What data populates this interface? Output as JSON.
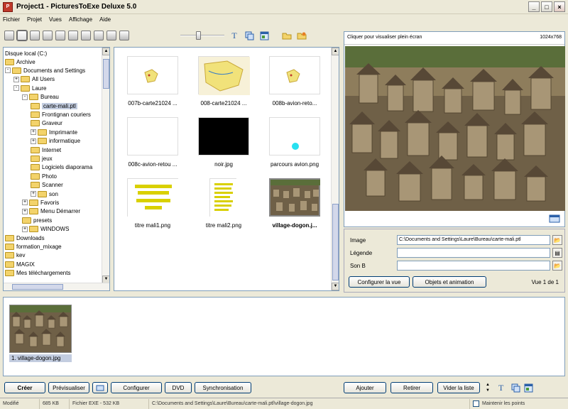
{
  "window": {
    "title": "Project1 - PicturesToExe Deluxe 5.0"
  },
  "menu": [
    "Fichier",
    "Projet",
    "Vues",
    "Affichage",
    "Aide"
  ],
  "toolbar": {
    "drives": [
      "A:",
      "C:",
      "D:",
      "E:",
      "F:",
      "G:",
      "H:",
      "I:",
      "J:",
      "K:"
    ],
    "zoom_level": 0.4
  },
  "tree": {
    "root": "Disque local (C:)",
    "items": [
      {
        "label": "Archive",
        "level": 1,
        "expander": ""
      },
      {
        "label": "Documents and Settings",
        "level": 1,
        "expander": "-"
      },
      {
        "label": "All Users",
        "level": 2,
        "expander": "+"
      },
      {
        "label": "Laure",
        "level": 2,
        "expander": "-"
      },
      {
        "label": "Bureau",
        "level": 3,
        "expander": "-"
      },
      {
        "label": "carte-mali.ptl",
        "level": 4,
        "expander": "",
        "selected": true
      },
      {
        "label": "Frontignan couriers",
        "level": 4,
        "expander": ""
      },
      {
        "label": "Graveur",
        "level": 4,
        "expander": ""
      },
      {
        "label": "Imprimante",
        "level": 4,
        "expander": "+"
      },
      {
        "label": "informatique",
        "level": 4,
        "expander": "+"
      },
      {
        "label": "Internet",
        "level": 4,
        "expander": ""
      },
      {
        "label": "jeux",
        "level": 4,
        "expander": ""
      },
      {
        "label": "Logiciels diaporama",
        "level": 4,
        "expander": ""
      },
      {
        "label": "Photo",
        "level": 4,
        "expander": ""
      },
      {
        "label": "Scanner",
        "level": 4,
        "expander": ""
      },
      {
        "label": "son",
        "level": 4,
        "expander": "+"
      },
      {
        "label": "Favoris",
        "level": 3,
        "expander": "+"
      },
      {
        "label": "Menu Démarrer",
        "level": 3,
        "expander": "+"
      },
      {
        "label": "presets",
        "level": 3,
        "expander": ""
      },
      {
        "label": "WINDOWS",
        "level": 3,
        "expander": "+"
      },
      {
        "label": "Downloads",
        "level": 1,
        "expander": ""
      },
      {
        "label": "formation_mixage",
        "level": 1,
        "expander": ""
      },
      {
        "label": "kev",
        "level": 1,
        "expander": ""
      },
      {
        "label": "MAGIX",
        "level": 1,
        "expander": ""
      },
      {
        "label": "Mes téléchargements",
        "level": 1,
        "expander": ""
      }
    ]
  },
  "files": [
    {
      "label": "007b-carte21024 ...",
      "kind": "map-small"
    },
    {
      "label": "008-carte21024 ...",
      "kind": "map"
    },
    {
      "label": "008b-avion-reto...",
      "kind": "map-small"
    },
    {
      "label": "008c-avion-retou ...",
      "kind": "blank"
    },
    {
      "label": "noir.jpg",
      "kind": "black"
    },
    {
      "label": "parcours avion.png",
      "kind": "dot"
    },
    {
      "label": "titre mali1.png",
      "kind": "title1"
    },
    {
      "label": "titre mali2.png",
      "kind": "title2"
    },
    {
      "label": "village-dogon.j...",
      "kind": "photo",
      "selected": true
    }
  ],
  "preview": {
    "hint": "Cliquer pour visualiser plein écran",
    "resolution": "1024x768"
  },
  "properties": {
    "image_label": "Image",
    "image_value": "C:\\Documents and Settings\\Laure\\Bureau\\carte-mali.ptl",
    "legend_label": "Légende",
    "legend_value": "",
    "sound_label": "Son B",
    "sound_value": "",
    "configure_button": "Configurer la vue",
    "objects_button": "Objets et animation",
    "view_count": "Vue 1 de 1"
  },
  "slides": [
    {
      "label": "1. village-dogon.jpg"
    }
  ],
  "bottom": {
    "create": "Créer",
    "preview": "Prévisualiser",
    "configure": "Configurer",
    "dvd": "DVD",
    "sync": "Synchronisation",
    "add": "Ajouter",
    "remove": "Retirer",
    "clear": "Vider la liste"
  },
  "status": {
    "state": "Modifié",
    "size": "685 KB",
    "file_info": "Fichier EXE - 532 KB",
    "path": "C:\\Documents and Settings\\Laure\\Bureau\\carte-mali.ptl\\village-dogon.jpg",
    "keep_points": "Maintenir les points"
  }
}
